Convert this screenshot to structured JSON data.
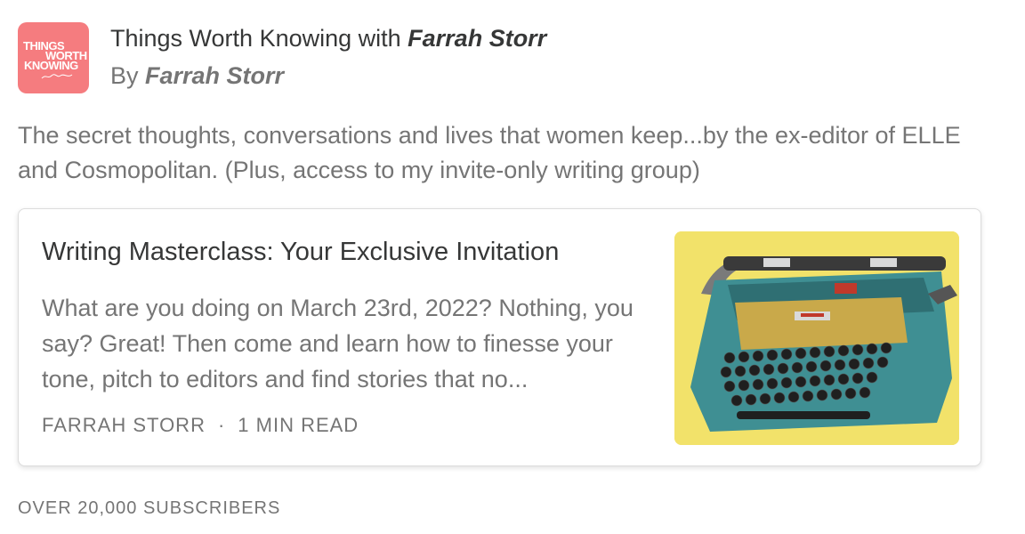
{
  "publication": {
    "logo_lines": [
      "THINGS",
      "WORTH",
      "KNOWING"
    ],
    "title_prefix": "Things Worth Knowing with ",
    "title_author": "Farrah Storr",
    "byline_prefix": "By ",
    "byline_author": "Farrah Storr",
    "description": "The secret thoughts, conversations and lives that women keep...by the ex-editor of ELLE and Cosmopolitan. (Plus, access to my invite-only writing group)"
  },
  "post": {
    "title": "Writing Masterclass: Your Exclusive Invitation",
    "excerpt": "What are you doing on March 23rd, 2022? Nothing, you say? Great! Then come and learn how to finesse your tone, pitch to editors and find stories that no...",
    "author": "FARRAH STORR",
    "separator": "·",
    "read_time": "1 MIN READ"
  },
  "footer": {
    "subscribers": "OVER 20,000 SUBSCRIBERS"
  },
  "colors": {
    "logo_bg": "#f57c7f",
    "thumb_bg": "#f2e26a",
    "typewriter_body": "#3f8f93",
    "text_primary": "#363737",
    "text_secondary": "#757575"
  }
}
